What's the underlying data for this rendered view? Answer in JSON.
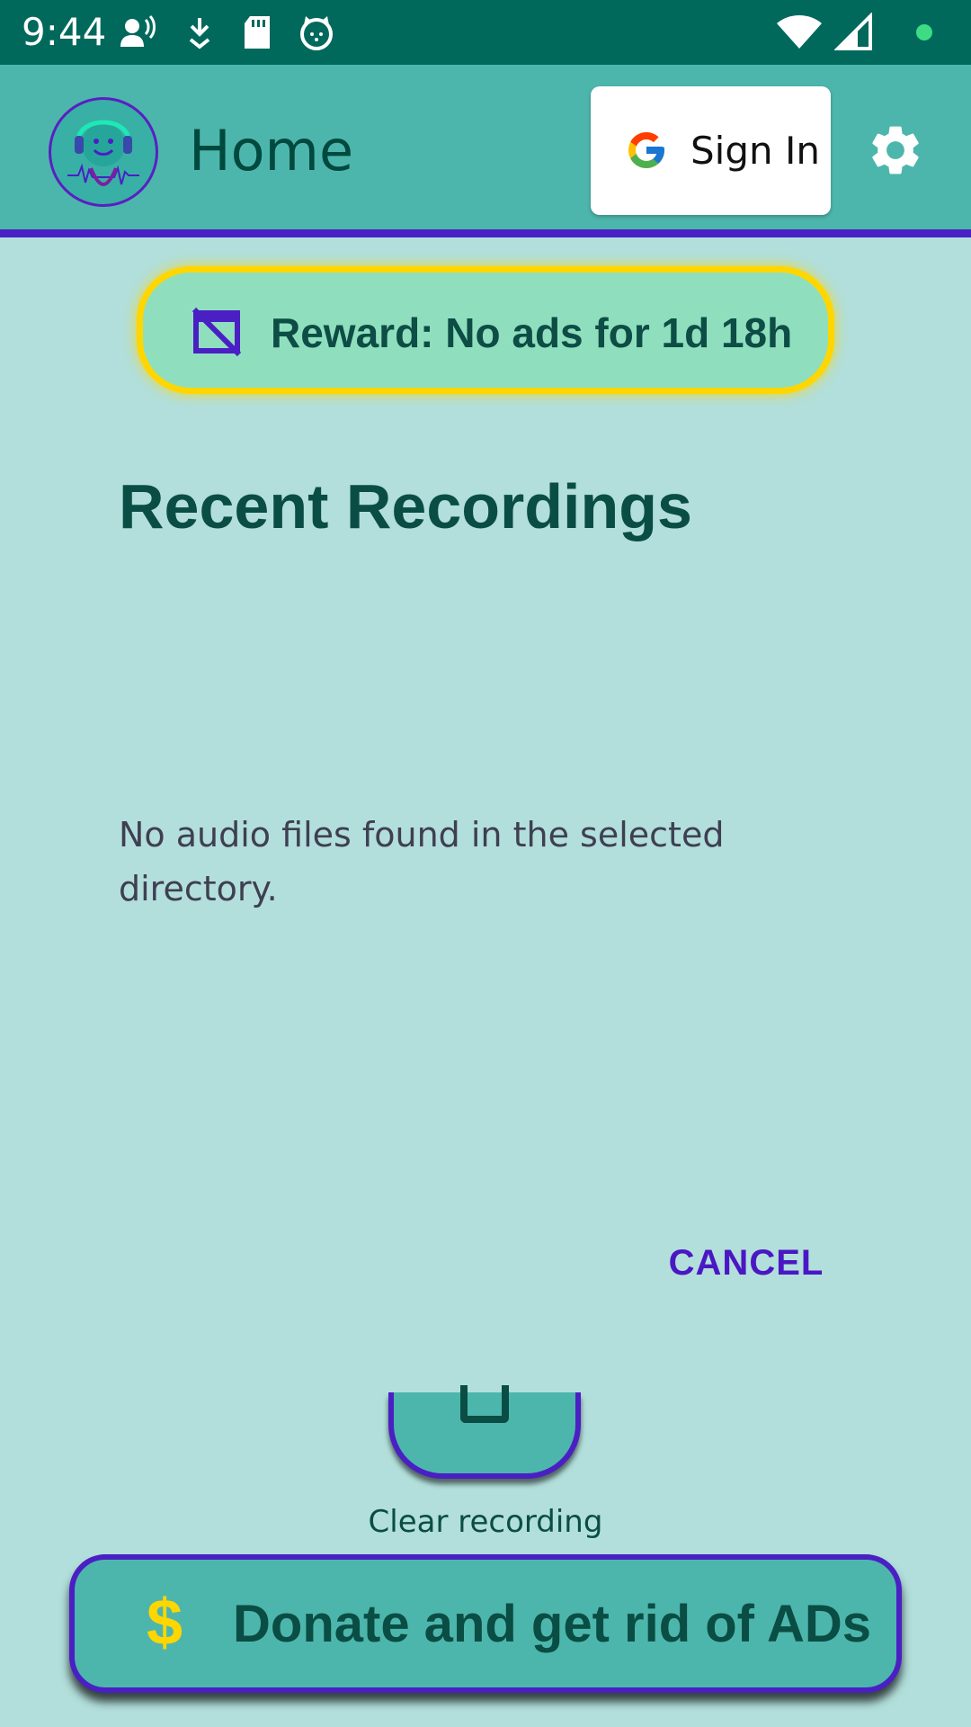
{
  "status_bar": {
    "time": "9:44",
    "icons": [
      "voice-icon",
      "download-icon",
      "sd-card-icon",
      "cat-icon",
      "wifi-icon",
      "signal-icon",
      "dot-icon"
    ]
  },
  "app_bar": {
    "title": "Home",
    "signin_label": "Sign In",
    "settings_icon": "gear-icon"
  },
  "reward": {
    "label": "Reward: No ads for 1d 18h",
    "icon": "no-ads-icon"
  },
  "recordings": {
    "title": "Recent Recordings",
    "empty_message": "No audio files found in the selected directory.",
    "cancel_label": "CANCEL"
  },
  "clear": {
    "label": "Clear recording"
  },
  "donate": {
    "icon": "$",
    "label": "Donate and get rid of ADs"
  },
  "colors": {
    "status_bar": "#00695c",
    "app_bar": "#4db6ac",
    "background": "#b2dfdb",
    "accent_purple": "#4a1fc4",
    "reward_border": "#ffd600",
    "text_dark": "#0a4d44"
  }
}
